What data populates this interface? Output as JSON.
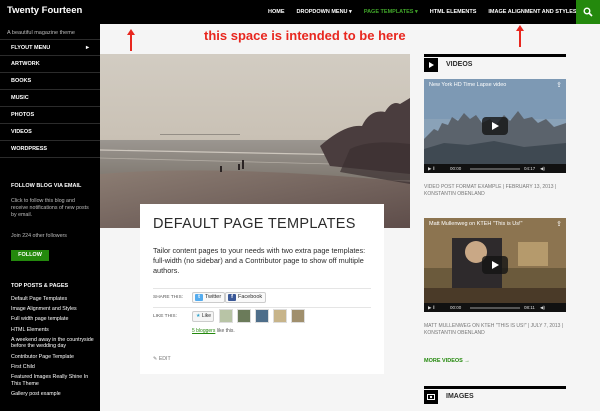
{
  "site": {
    "title": "Twenty Fourteen",
    "description": "A beautiful magazine theme"
  },
  "top_nav": {
    "items": [
      {
        "label": "HOME",
        "active": false
      },
      {
        "label": "DROPDOWN MENU ▾",
        "active": false
      },
      {
        "label": "PAGE TEMPLATES ▾",
        "active": true
      },
      {
        "label": "HTML ELEMENTS",
        "active": false
      },
      {
        "label": "IMAGE ALIGNMENT AND STYLES",
        "active": false
      }
    ],
    "search_icon": "search-icon"
  },
  "annotation": {
    "text": "this space is intended to be here"
  },
  "sidebar": {
    "menu": [
      {
        "label": "FLYOUT MENU",
        "arrow": "▸"
      },
      {
        "label": "ARTWORK"
      },
      {
        "label": "BOOKS"
      },
      {
        "label": "MUSIC"
      },
      {
        "label": "PHOTOS"
      },
      {
        "label": "VIDEOS"
      },
      {
        "label": "WORDPRESS"
      }
    ],
    "follow_widget": {
      "title": "FOLLOW BLOG VIA EMAIL",
      "text": "Click to follow this blog and receive notifications of new posts by email.",
      "count_text": "Join 224 other followers",
      "button": "FOLLOW"
    },
    "top_posts": {
      "title": "TOP POSTS & PAGES",
      "items": [
        "Default Page Templates",
        "Image Alignment and Styles",
        "Full width page template",
        "HTML Elements",
        "A weekend away in the countryside before the wedding day",
        "Contributor Page Template",
        "First Child",
        "Featured Images Really Shine In This Theme",
        "Gallery post example"
      ]
    }
  },
  "main": {
    "page_title": "DEFAULT PAGE TEMPLATES",
    "intro": "Tailor content pages to your needs with two extra page templates: full-width (no sidebar) and a Contributor page to show off multiple authors.",
    "share_label": "SHARE THIS:",
    "share_buttons": [
      "Twitter",
      "Facebook"
    ],
    "like_label": "LIKE THIS:",
    "like_button": "Like",
    "bloggers_link": "5 bloggers",
    "bloggers_suffix": "like this.",
    "edit_label": "EDIT"
  },
  "right_sidebar": {
    "videos_title": "VIDEOS",
    "videos": [
      {
        "title": "New York HD Time Lapse video",
        "time": "00:00",
        "duration": "04:17",
        "caption": "VIDEO POST FORMAT EXAMPLE | FEBRUARY 13, 2013 | KONSTANTIN OBENLAND"
      },
      {
        "title": "Matt Mullenweg on KTEH \"This is Us!\"",
        "time": "00:00",
        "duration": "08:11",
        "caption": "MATT MULLENWEG ON KTEH \"THIS IS US!\" | JULY 7, 2013 | KONSTANTIN OBENLAND"
      }
    ],
    "more_videos": "MORE VIDEOS →",
    "images_title": "IMAGES"
  },
  "colors": {
    "accent": "#24890d",
    "accent_light": "#41a62a",
    "header_bg": "#000000",
    "annotation": "#e8271f"
  }
}
